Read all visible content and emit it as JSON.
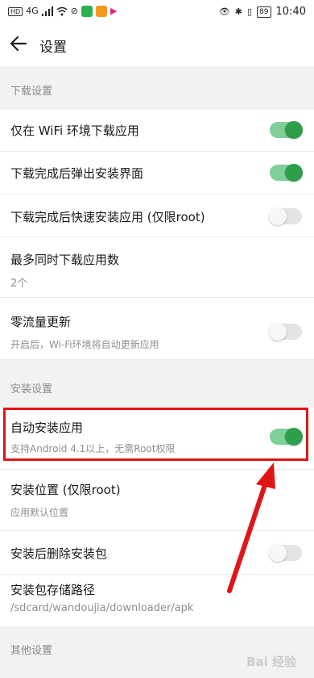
{
  "status_bar": {
    "left_badge": "HD",
    "network": "4G",
    "battery": "89",
    "time": "10:40"
  },
  "header": {
    "title": "设置"
  },
  "sections": {
    "download": "下载设置",
    "install": "安装设置",
    "other": "其他设置"
  },
  "rows": {
    "wifi_only": {
      "title": "仅在 WiFi 环境下载应用",
      "toggle": true
    },
    "popup_install": {
      "title": "下载完成后弹出安装界面",
      "toggle": true
    },
    "quick_install": {
      "title": "下载完成后快速安装应用 (仅限root)",
      "toggle": false
    },
    "max_downloads": {
      "title": "最多同时下载应用数",
      "value": "2个"
    },
    "zero_data": {
      "title": "零流量更新",
      "subtitle": "开启后，Wi-Fi环境将自动更新应用",
      "toggle": false
    },
    "auto_install": {
      "title": "自动安装应用",
      "subtitle": "支持Android 4.1以上，无需Root权限",
      "toggle": true
    },
    "install_location": {
      "title": "安装位置 (仅限root)",
      "subtitle": "应用默认位置"
    },
    "delete_after": {
      "title": "安装后删除安装包",
      "toggle": false
    },
    "storage_path": {
      "title": "安装包存储路径",
      "subtitle": "/sdcard/wandoujia/downloader/apk"
    }
  },
  "colors": {
    "toggle_on_track": "#7fcf9a",
    "toggle_on_knob": "#2e9e4c",
    "highlight": "#e01515"
  },
  "watermark": "Bai 经验"
}
